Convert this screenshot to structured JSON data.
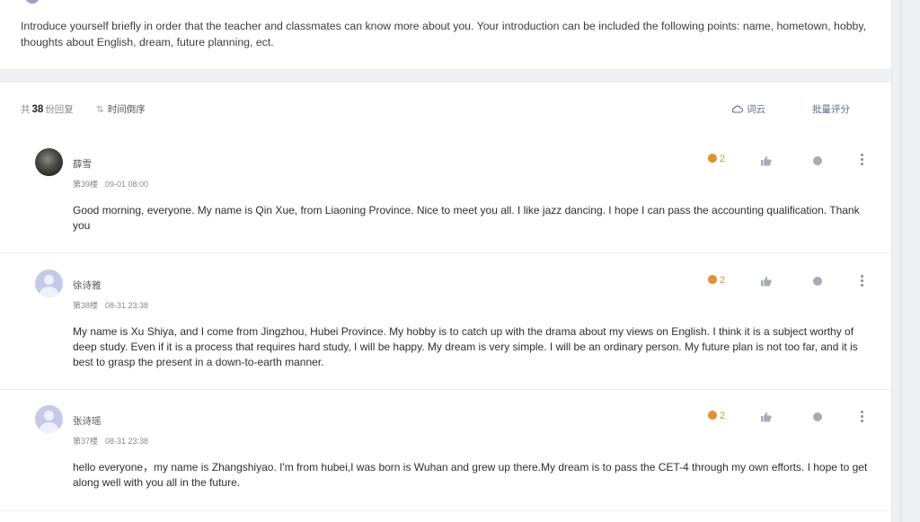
{
  "prompt": {
    "text": "Introduce yourself briefly in order that the teacher and classmates can know more about you. Your introduction can be included the following points: name, hometown, hobby, thoughts about English, dream, future planning, ect."
  },
  "toolbar": {
    "count_prefix": "共",
    "count_value": "38",
    "count_suffix": "份回复",
    "sort_icon": "sort-arrows-icon",
    "sort_label": "时间倒序",
    "cloud_icon": "cloud-icon",
    "cloud_label": "词云",
    "batch_label": "批量评分"
  },
  "replies": [
    {
      "name": "薛雪",
      "floor": "第39楼",
      "time": "09-01 08:00",
      "content": "Good morning, everyone. My name is Qin Xue, from Liaoning Province. Nice to meet you all. I like jazz dancing. I hope I can pass the accounting qualification. Thank you",
      "score": "2",
      "avatar": "photo"
    },
    {
      "name": "徐诗雅",
      "floor": "第38楼",
      "time": "08-31 23:38",
      "content": "My name is Xu Shiya, and I come from Jingzhou, Hubei Province. My hobby is to catch up with the drama about my views on English. I think it is a subject worthy of deep study. Even if it is a process that requires hard study, I will be happy. My dream is very simple. I will be an ordinary person. My future plan is not too far, and it is best to grasp the present in a down-to-earth manner.",
      "score": "2",
      "avatar": "default"
    },
    {
      "name": "张诗瑶",
      "floor": "第37楼",
      "time": "08-31 23:38",
      "content": "hello everyone，my name is Zhangshiyao. I'm from hubei,I was born is Wuhan and grew up there.My dream is to pass the CET-4 through my own efforts. I hope to get along well with you all in the future.",
      "score": "2",
      "avatar": "default"
    }
  ],
  "colors": {
    "accent": "#e0922e",
    "link": "#5b6b8c",
    "avatar_default": "#c3c9e6"
  }
}
